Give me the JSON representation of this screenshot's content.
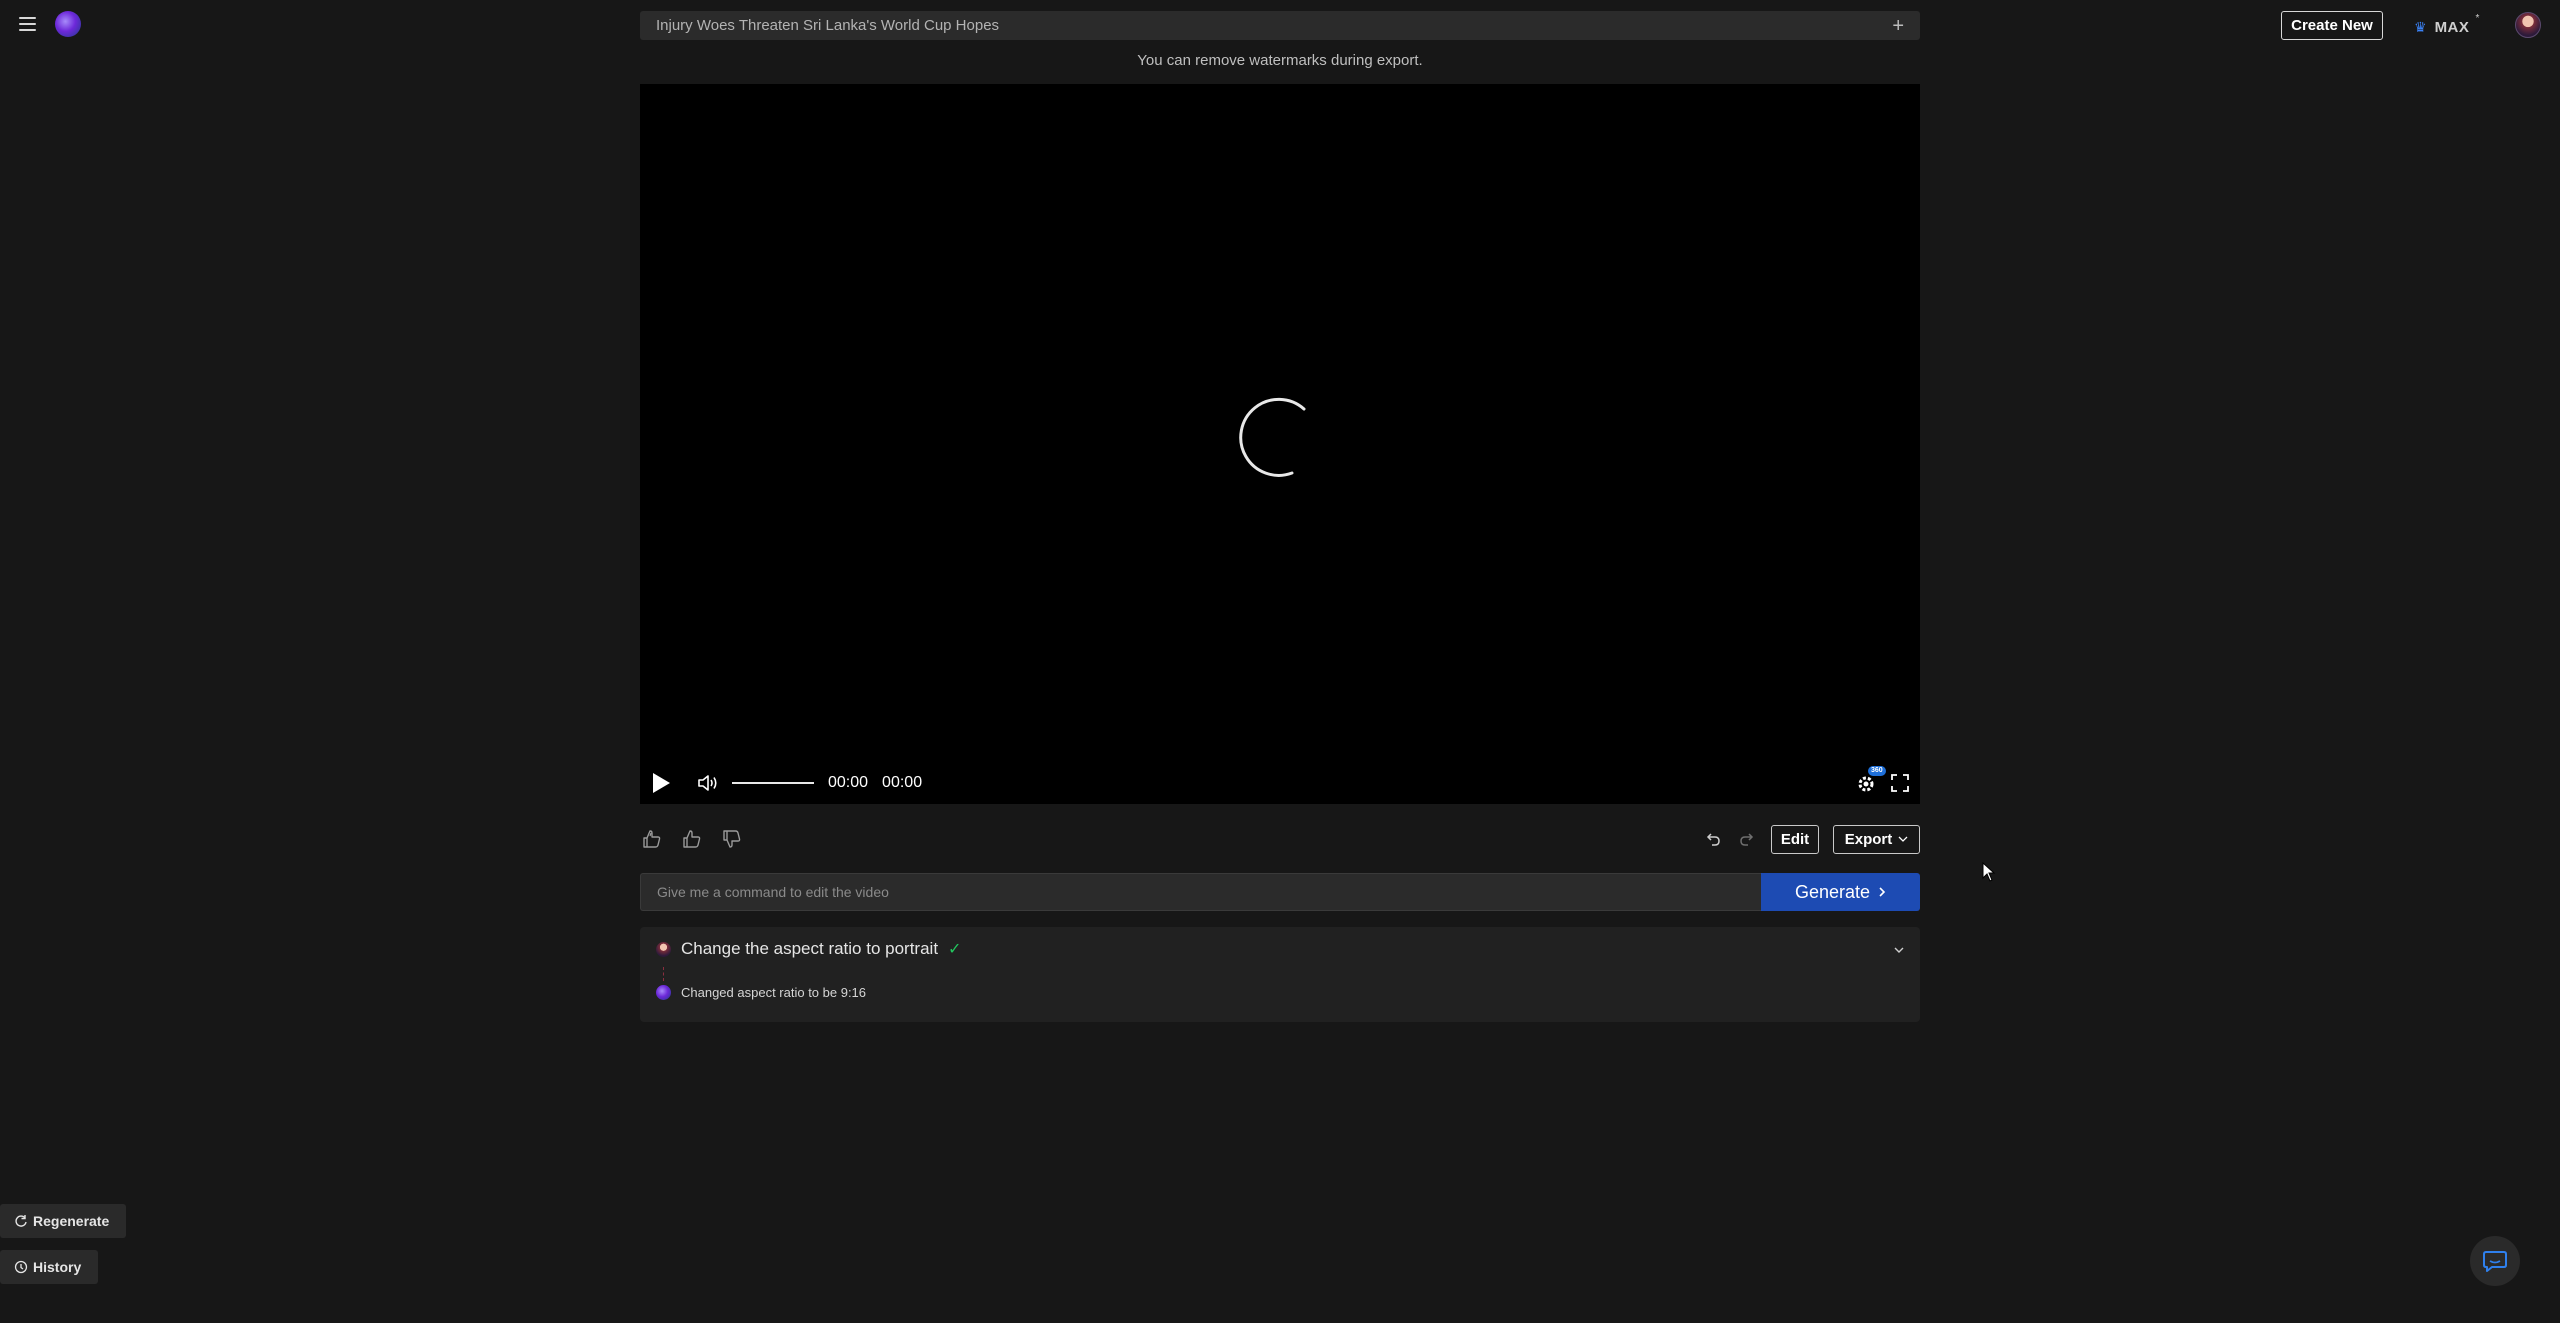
{
  "header": {
    "project_title": "Injury Woes Threaten Sri Lanka's World Cup Hopes",
    "create_new_label": "Create New",
    "plan_label": "MAX",
    "plan_marker": "*"
  },
  "notice": "You can remove watermarks during export.",
  "player": {
    "current_time": "00:00",
    "duration": "00:00",
    "quality_badge": "360",
    "volume_level": 1.0
  },
  "actions": {
    "edit_label": "Edit",
    "export_label": "Export"
  },
  "command": {
    "placeholder": "Give me a command to edit the video",
    "generate_label": "Generate"
  },
  "history": {
    "user_message": "Change the aspect ratio to portrait",
    "bot_message": "Changed aspect ratio to be 9:16"
  },
  "sidebar": {
    "regenerate_label": "Regenerate",
    "history_label": "History"
  },
  "colors": {
    "background": "#171717",
    "accent": "#1d4bb3",
    "success": "#22c55e"
  }
}
